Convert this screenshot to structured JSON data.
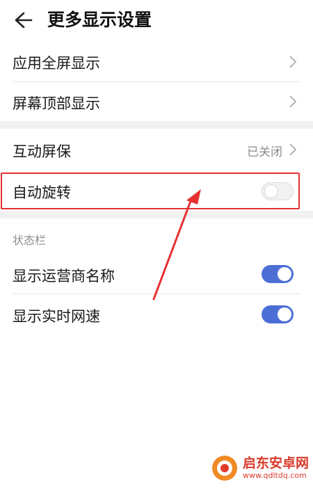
{
  "header": {
    "title": "更多显示设置",
    "back_icon": "arrow-left-icon"
  },
  "rows": {
    "fullscreen": {
      "label": "应用全屏显示"
    },
    "top_display": {
      "label": "屏幕顶部显示"
    },
    "screensaver": {
      "label": "互动屏保",
      "value": "已关闭"
    },
    "auto_rotate": {
      "label": "自动旋转",
      "enabled": false
    }
  },
  "status_bar": {
    "section_title": "状态栏",
    "carrier": {
      "label": "显示运营商名称",
      "enabled": true
    },
    "netspeed": {
      "label": "显示实时网速",
      "enabled": true
    }
  },
  "colors": {
    "accent": "#4c6fd6",
    "annotation": "#e53030"
  },
  "watermark": {
    "name": "启东安卓网",
    "url": "www.qdltdq.com"
  }
}
